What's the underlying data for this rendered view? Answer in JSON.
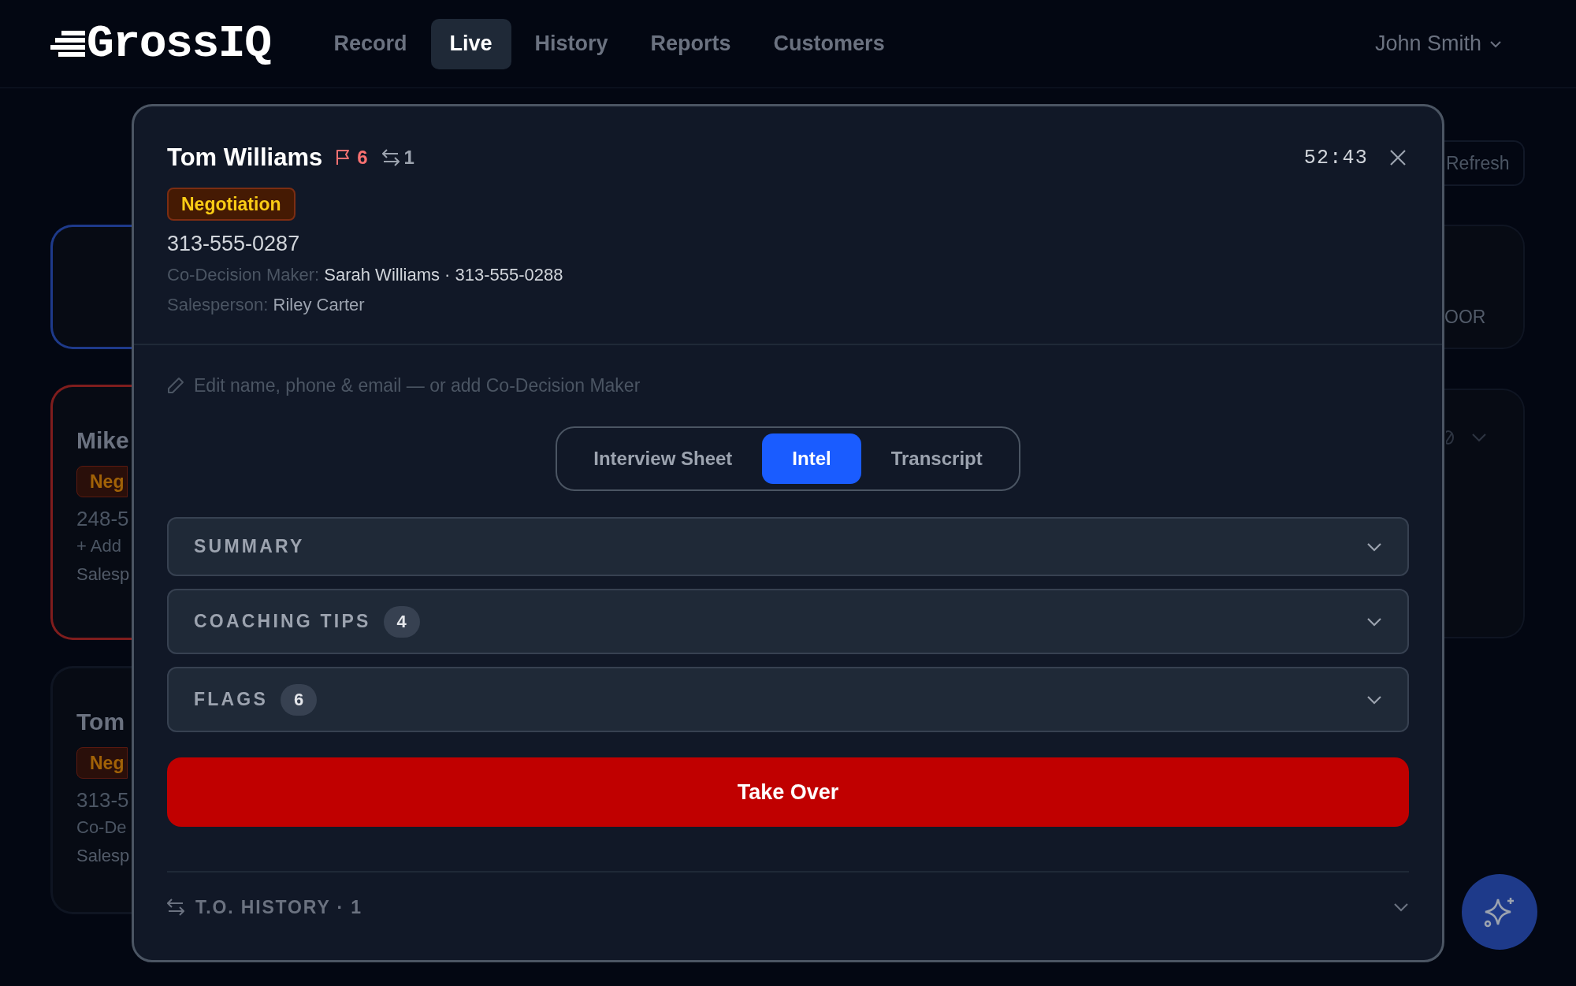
{
  "nav": {
    "logo": "GrossIQ",
    "items": [
      {
        "label": "Record",
        "selected": false
      },
      {
        "label": "Live",
        "selected": true
      },
      {
        "label": "History",
        "selected": false
      },
      {
        "label": "Reports",
        "selected": false
      },
      {
        "label": "Customers",
        "selected": false
      }
    ],
    "user": "John Smith"
  },
  "background": {
    "refresh_button": "Refresh",
    "left_cards": [
      {
        "color": "#1e3a8a"
      },
      {
        "color": "#7f1d1d",
        "name": "Mike",
        "badge": "Neg",
        "phone": "248-5",
        "line_1": "+ Add",
        "line_2": "Salesp"
      },
      {
        "name": "Tom",
        "badge": "Neg",
        "phone": "313-5",
        "line_1": "Co-De",
        "line_2": "Salesp"
      }
    ],
    "right_cards": [
      {
        "text": "OOR"
      },
      {
        "kind": "expandable",
        "expanded": false
      }
    ]
  },
  "modal": {
    "name": "Tom Williams",
    "flag_count": "6",
    "transfer_count": "1",
    "timer": "52:43",
    "stage": "Negotiation",
    "phone": "313-555-0287",
    "co_decision_label": "Co-Decision Maker:",
    "co_decision_value": "Sarah Williams · 313-555-0288",
    "salesperson_label": "Salesperson:",
    "salesperson_value": "Riley Carter",
    "edit_link": "Edit name, phone & email — or add Co-Decision Maker",
    "tabs": [
      {
        "label": "Interview Sheet",
        "selected": false
      },
      {
        "label": "Intel",
        "selected": true
      },
      {
        "label": "Transcript",
        "selected": false
      }
    ],
    "sections": [
      {
        "title": "SUMMARY",
        "expanded": false
      },
      {
        "title": "COACHING TIPS",
        "count": "4",
        "expanded": false
      },
      {
        "title": "FLAGS",
        "count": "6",
        "expanded": false
      }
    ],
    "primary_button": "Take Over",
    "history": {
      "label": "T.O. HISTORY · 1",
      "expanded": false
    }
  }
}
